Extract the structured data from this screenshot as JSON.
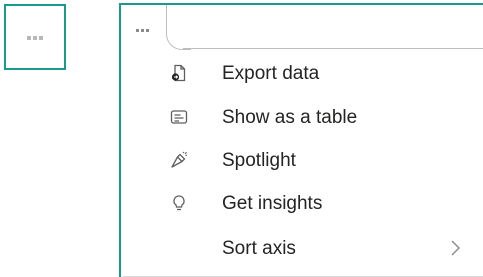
{
  "left_button": {
    "icon": "more-options-icon"
  },
  "menu": {
    "trigger_icon": "more-options-icon",
    "items": [
      {
        "label": "Export data",
        "icon": "export-data-icon"
      },
      {
        "label": "Show as a table",
        "icon": "show-table-icon"
      },
      {
        "label": "Spotlight",
        "icon": "spotlight-icon"
      },
      {
        "label": "Get insights",
        "icon": "lightbulb-icon"
      },
      {
        "label": "Sort axis",
        "icon": "chevron-right-icon"
      }
    ]
  },
  "colors": {
    "focus_border": "#1a9a8d",
    "text": "#252423",
    "icon": "#605e5c"
  }
}
